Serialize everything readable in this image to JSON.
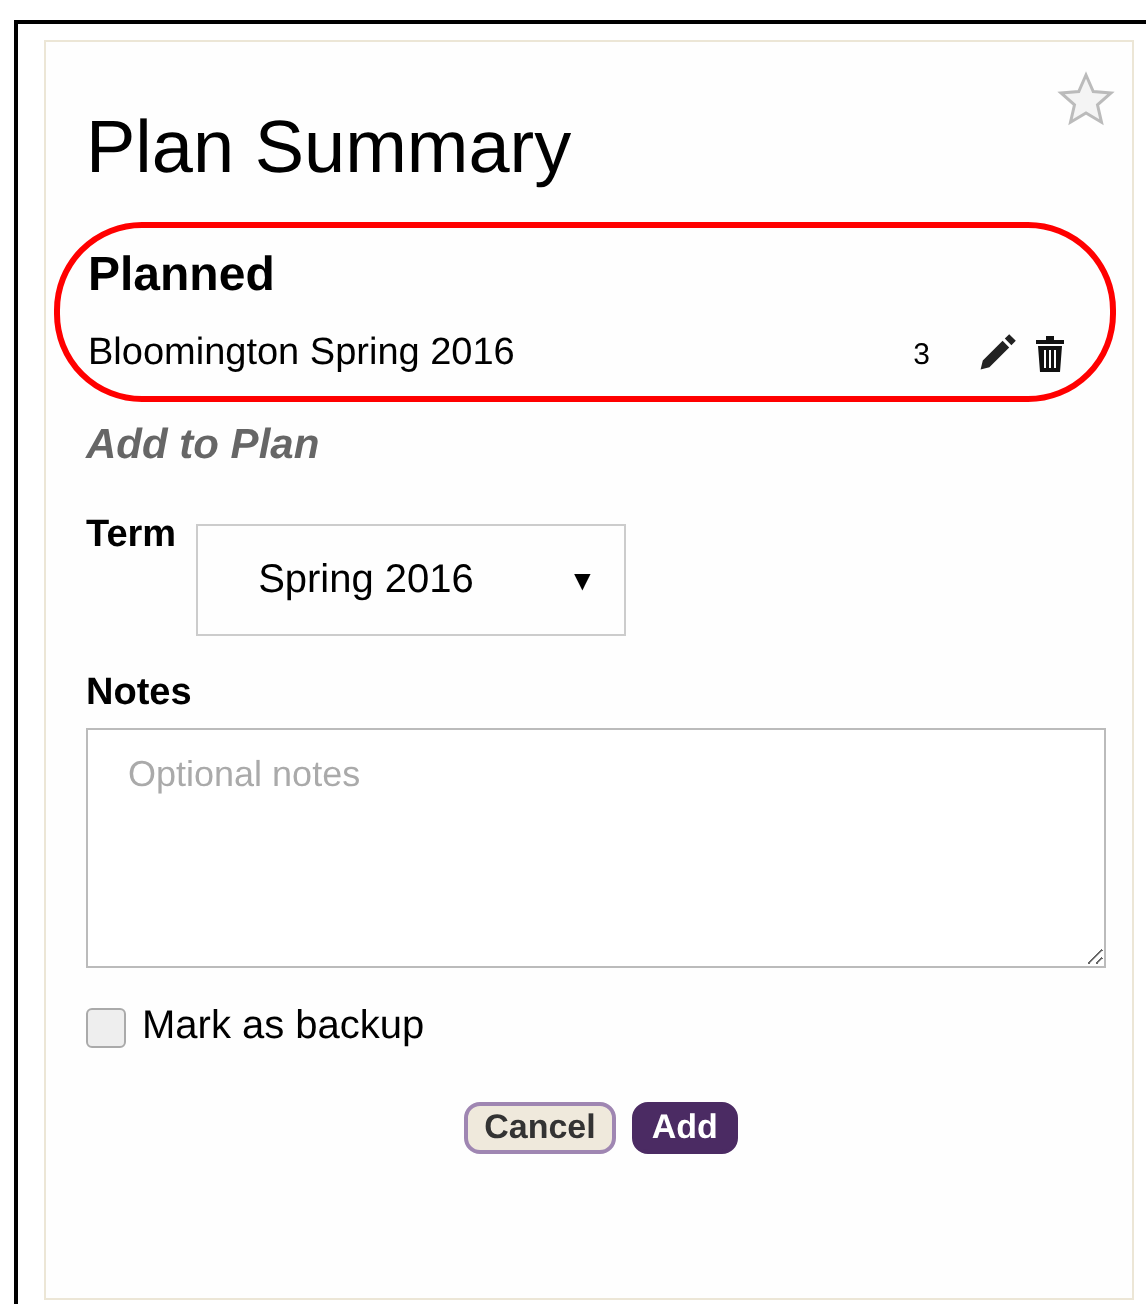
{
  "title": "Plan Summary",
  "starred": false,
  "planned": {
    "heading": "Planned",
    "items": [
      {
        "name": "Bloomington Spring 2016",
        "count": "3"
      }
    ]
  },
  "add_heading": "Add to Plan",
  "term": {
    "label": "Term",
    "value": "Spring 2016",
    "caret": "▼"
  },
  "notes": {
    "label": "Notes",
    "placeholder": "Optional notes"
  },
  "backup": {
    "label": "Mark as backup",
    "checked": false
  },
  "buttons": [
    {
      "label": "Cancel",
      "kind": "secondary"
    },
    {
      "label": "Add",
      "kind": "primary"
    }
  ]
}
